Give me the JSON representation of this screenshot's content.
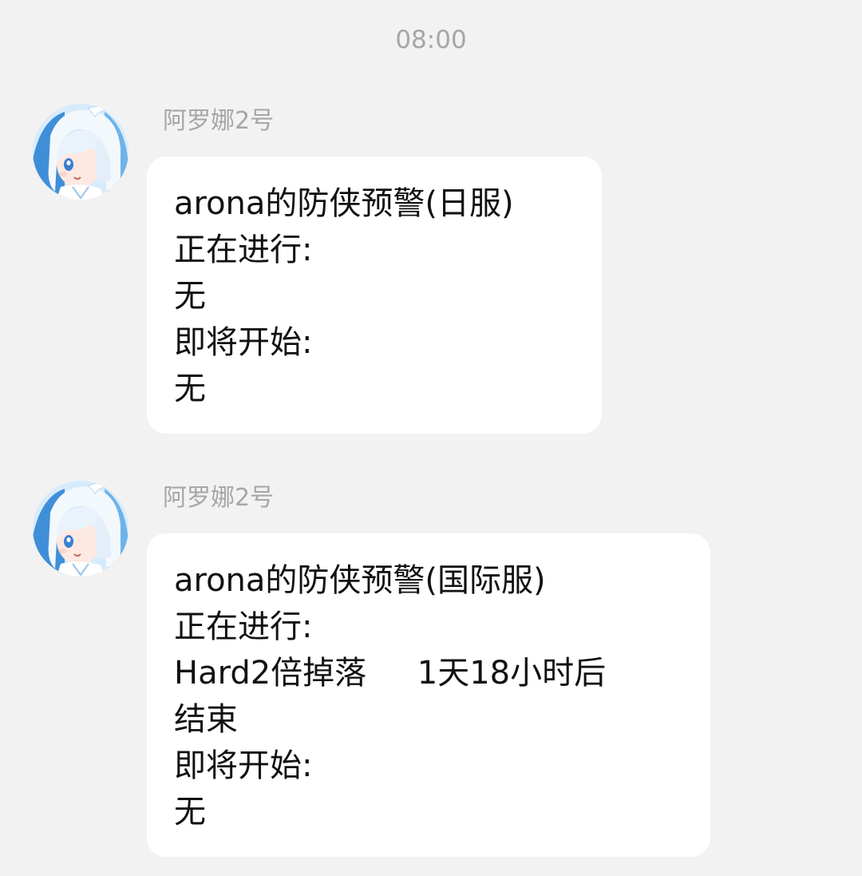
{
  "timestamp": "08:00",
  "messages": [
    {
      "sender": "阿罗娜2号",
      "lines": [
        "arona的防侠预警(日服)",
        "正在进行:",
        "无",
        "即将开始:",
        "无"
      ]
    },
    {
      "sender": "阿罗娜2号",
      "lines": [
        "arona的防侠预警(国际服)",
        "正在进行:",
        "Hard2倍掉落     1天18小时后",
        "结束",
        "即将开始:",
        "无"
      ]
    }
  ],
  "icons": {
    "avatar": "avatar-icon"
  },
  "colors": {
    "background": "#f2f2f2",
    "bubble": "#ffffff",
    "meta_text": "#a6a6a6",
    "message_text": "#111111"
  }
}
